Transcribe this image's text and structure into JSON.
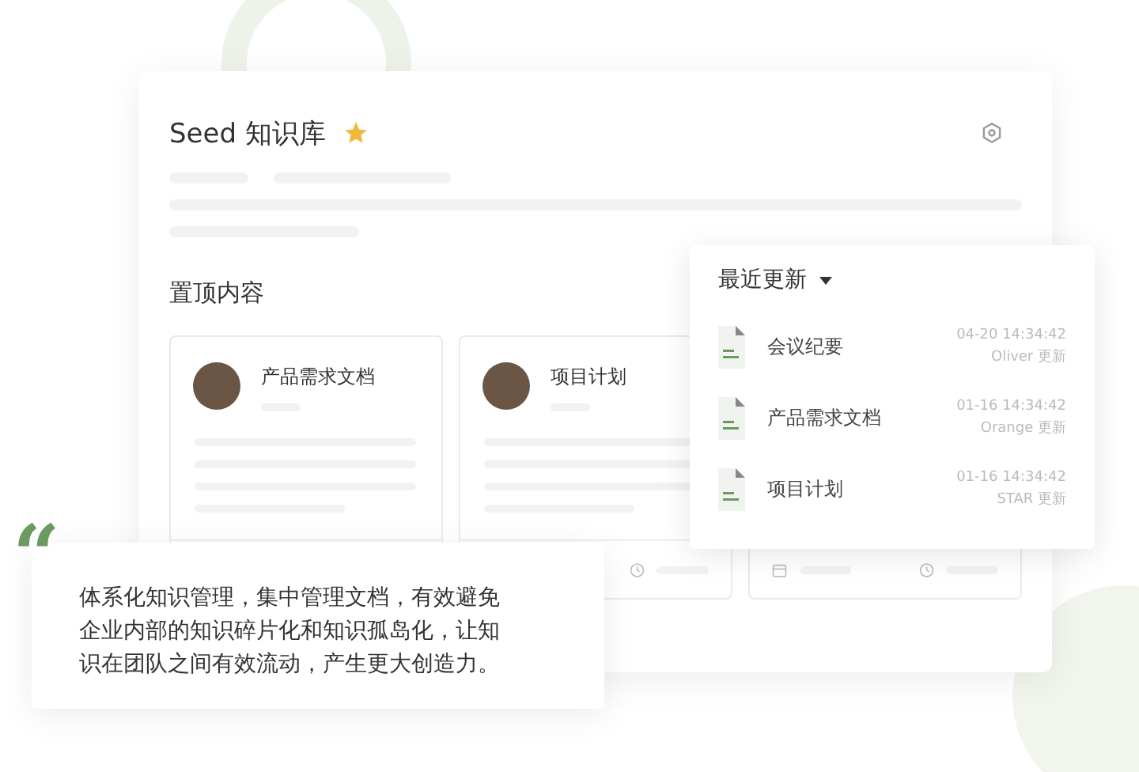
{
  "header": {
    "title": "Seed 知识库",
    "starred": true
  },
  "pinned": {
    "heading": "置顶内容",
    "cards": [
      {
        "title": "产品需求文档"
      },
      {
        "title": "项目计划"
      }
    ]
  },
  "recent": {
    "title": "最近更新",
    "items": [
      {
        "name": "会议纪要",
        "time": "04-20 14:34:42",
        "updater": "Oliver 更新"
      },
      {
        "name": "产品需求文档",
        "time": "01-16 14:34:42",
        "updater": "Orange 更新"
      },
      {
        "name": "项目计划",
        "time": "01-16 14:34:42",
        "updater": "STAR 更新"
      }
    ]
  },
  "quote": {
    "mark": "“",
    "text": "体系化知识管理，集中管理文档，有效避免企业内部的知识碎片化和知识孤岛化，让知识在团队之间有效流动，产生更大创造力。"
  }
}
